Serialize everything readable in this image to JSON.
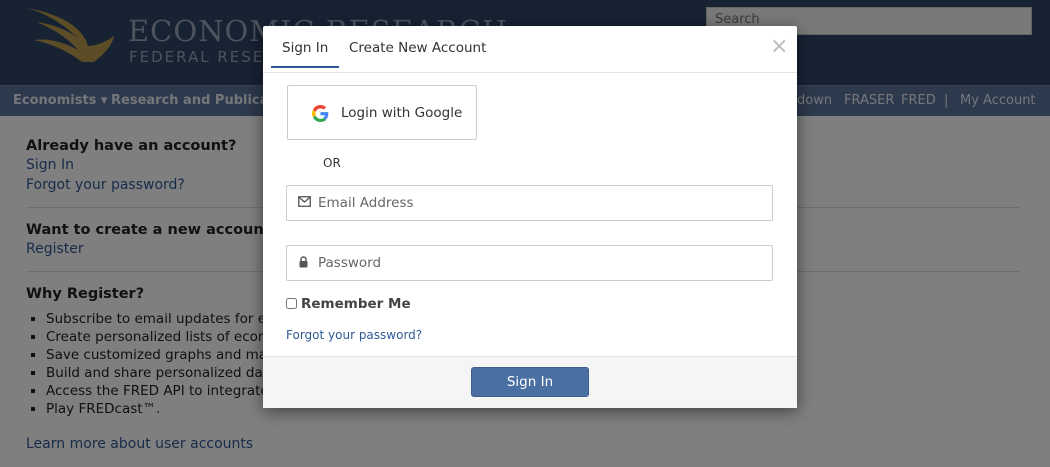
{
  "header": {
    "logo_title": "ECONOMIC RESEARCH",
    "logo_subtitle": "FEDERAL RESERVE BANK OF ST. LOUIS",
    "search_placeholder": "Search"
  },
  "nav": {
    "economists": "Economists ▾",
    "research": "Research and Publications",
    "fraser_link": "FRASER",
    "fred_link": "FRED",
    "separator": "|",
    "my_account": "My Account",
    "partial": "down"
  },
  "content": {
    "already_title": "Already have an account?",
    "sign_in_link": "Sign In",
    "forgot_link": "Forgot your password?",
    "create_title": "Want to create a new account?",
    "register_link": "Register",
    "why_title": "Why Register?",
    "bullets": [
      "Subscribe to email updates for eco",
      "Create personalized lists of econon",
      "Save customized graphs and maps",
      "Build and share personalized dash",
      "Access the FRED API to integrate d",
      "Play FREDcast™."
    ],
    "learn_more": "Learn more about user accounts"
  },
  "modal": {
    "tab_signin": "Sign In",
    "tab_create": "Create New Account",
    "close_symbol": "×",
    "google_label": "Login with Google",
    "or_text": "OR",
    "email_placeholder": "Email Address",
    "password_placeholder": "Password",
    "remember_label": "Remember Me",
    "forgot_link": "Forgot your password?",
    "signin_button": "Sign In"
  },
  "colors": {
    "header_bg": "#2f4466",
    "nav_bg": "#5b7398",
    "link": "#2f5a94",
    "primary_button": "#4a6fa3"
  }
}
